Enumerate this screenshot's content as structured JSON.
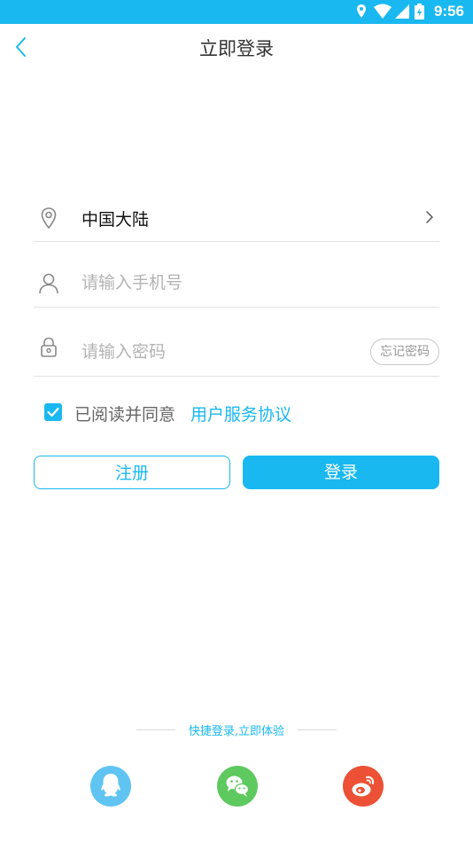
{
  "status_bar": {
    "time": "9:56",
    "icons": [
      "location-icon",
      "wifi-icon",
      "signal-icon",
      "battery-icon"
    ]
  },
  "header": {
    "title": "立即登录",
    "back_icon": "chevron-left-icon"
  },
  "form": {
    "region": {
      "icon": "location-pin-icon",
      "value": "中国大陆",
      "arrow_icon": "chevron-right-icon"
    },
    "phone": {
      "icon": "user-icon",
      "placeholder": "请输入手机号",
      "value": ""
    },
    "password": {
      "icon": "lock-icon",
      "placeholder": "请输入密码",
      "value": "",
      "forgot_label": "忘记密码"
    },
    "agreement": {
      "checked": true,
      "text": "已阅读并同意",
      "link": "用户服务协议"
    }
  },
  "buttons": {
    "register_label": "注册",
    "login_label": "登录"
  },
  "quick_login": {
    "label": "快捷登录,立即体验",
    "providers": [
      {
        "name": "qq-icon",
        "color": "#5fc4f2"
      },
      {
        "name": "wechat-icon",
        "color": "#5ec95e"
      },
      {
        "name": "weibo-icon",
        "color": "#ec5035"
      }
    ]
  },
  "colors": {
    "accent": "#1ab8f0",
    "status_bar": "#1ab8f0"
  }
}
